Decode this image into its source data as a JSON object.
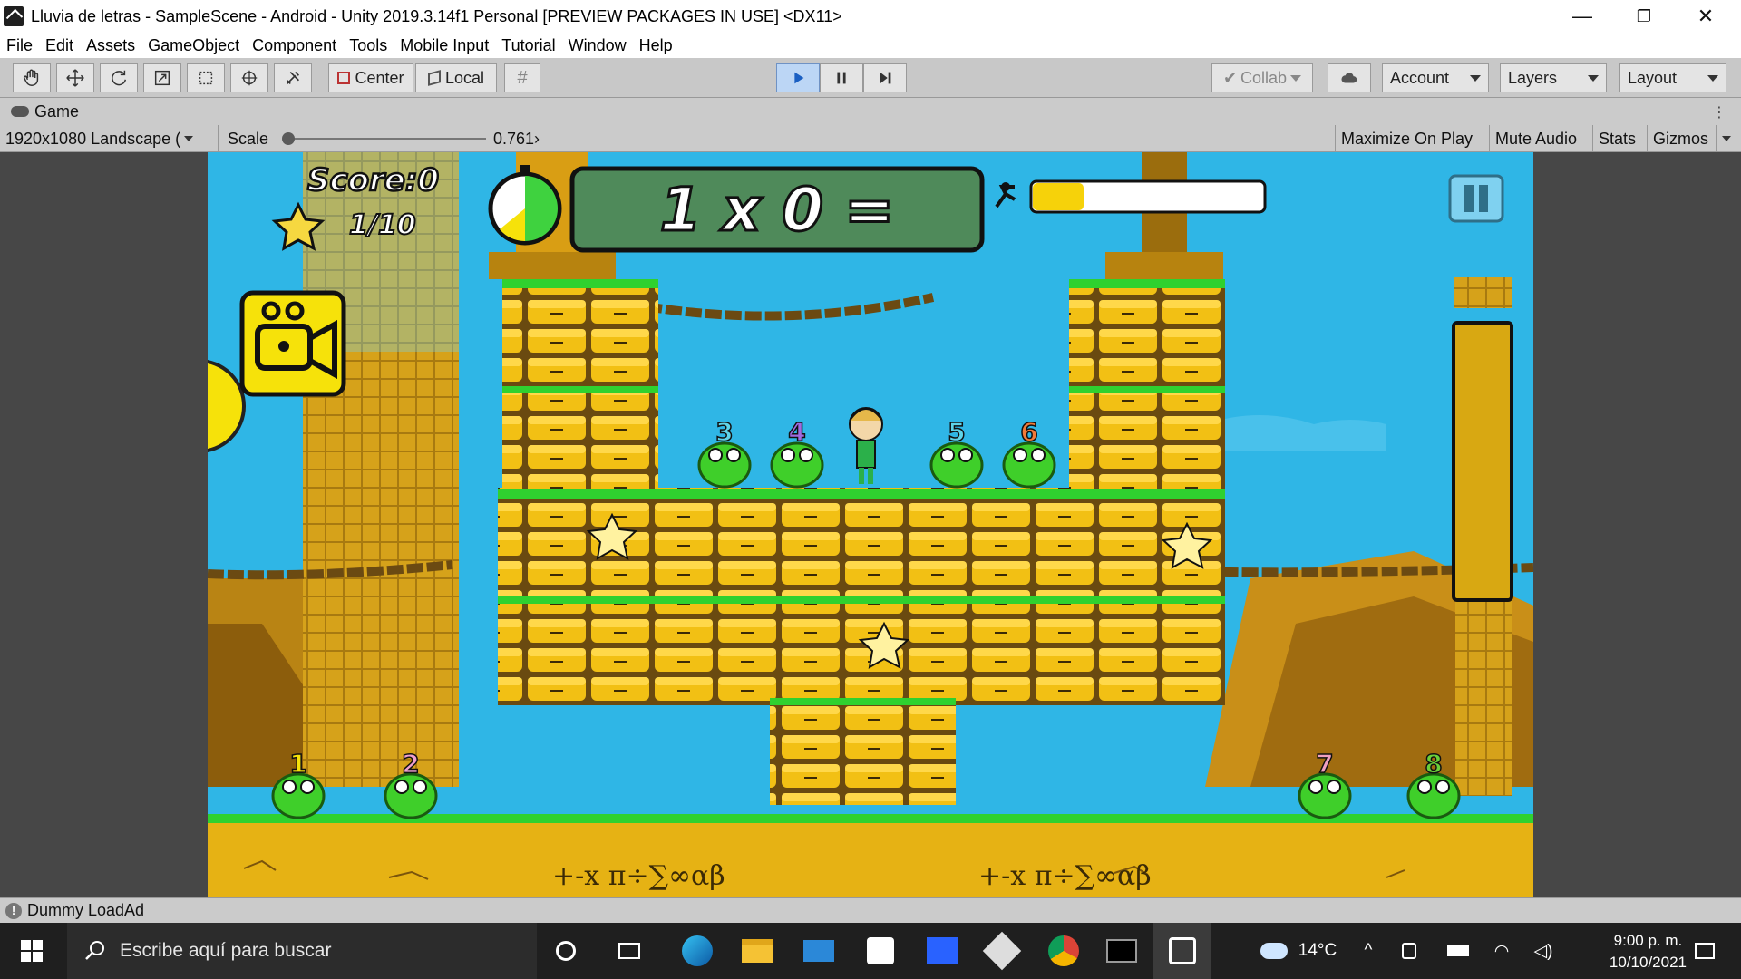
{
  "window": {
    "title": "Lluvia de letras - SampleScene - Android - Unity 2019.3.14f1 Personal [PREVIEW PACKAGES IN USE] <DX11>",
    "controls": {
      "minimize": "—",
      "maximize": "❐",
      "close": "✕"
    }
  },
  "menu": [
    "File",
    "Edit",
    "Assets",
    "GameObject",
    "Component",
    "Tools",
    "Mobile Input",
    "Tutorial",
    "Window",
    "Help"
  ],
  "toolbar": {
    "pivot_label": "Center",
    "space_label": "Local",
    "collab_label": "Collab",
    "account_label": "Account",
    "layers_label": "Layers",
    "layout_label": "Layout"
  },
  "game_tab": {
    "label": "Game"
  },
  "game_toolbar": {
    "resolution": "1920x1080 Landscape (",
    "scale_label": "Scale",
    "scale_value": "0.761",
    "scale_fraction": 0.0,
    "maximize_label": "Maximize On Play",
    "mute_label": "Mute Audio",
    "stats_label": "Stats",
    "gizmos_label": "Gizmos"
  },
  "game": {
    "score": "Score:0",
    "stars": "1/10",
    "equation": "1 x 0 =",
    "progress": 0.22,
    "math_symbols_left": "+-x π÷∑∞αβ",
    "math_symbols_right": "+-x π÷∑∞αβ",
    "colors": {
      "sky": "#2fb6e6",
      "brick": "#f2c014",
      "grass": "#2fd12f",
      "board": "#4f8a5a",
      "frog": "#3fcf2a"
    }
  },
  "status": {
    "message": "Dummy LoadAd"
  },
  "taskbar": {
    "search_placeholder": "Escribe aquí para buscar",
    "weather": "14°C",
    "time": "9:00 p. m.",
    "date": "10/10/2021"
  }
}
